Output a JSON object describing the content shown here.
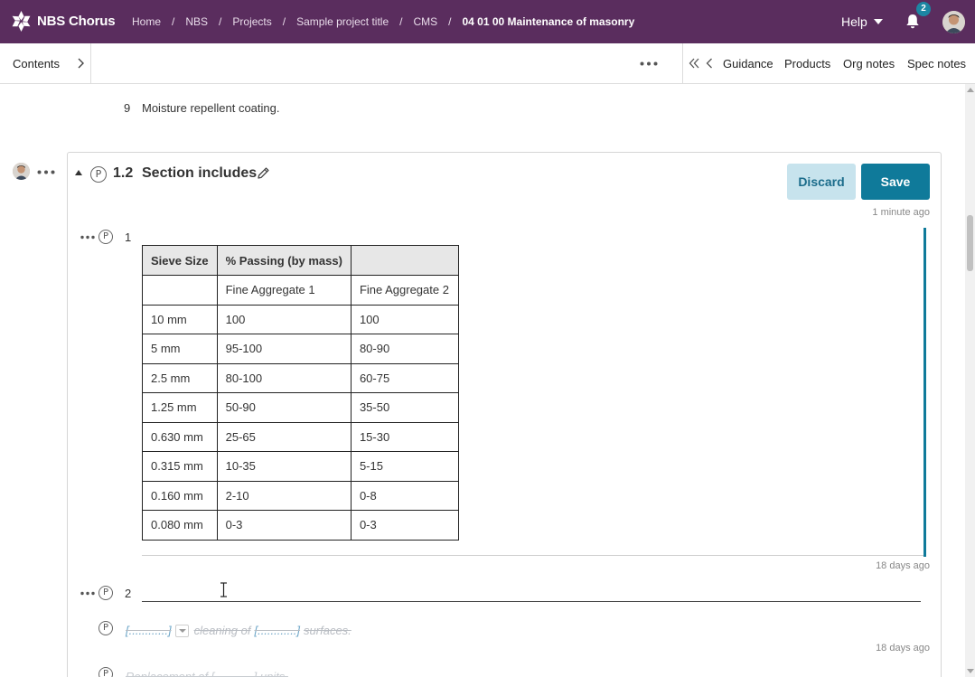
{
  "app": {
    "brand": "NBS Chorus",
    "breadcrumbs": [
      "Home",
      "NBS",
      "Projects",
      "Sample project title",
      "CMS",
      "04 01 00 Maintenance of masonry"
    ],
    "help_label": "Help",
    "notification_count": "2",
    "colors": {
      "header_bg": "#5a2d5e",
      "accent": "#0f7a9a",
      "discard_bg": "#c7e3ed"
    }
  },
  "toolbar": {
    "contents_label": "Contents",
    "right_tabs": [
      "Guidance",
      "Products",
      "Org notes",
      "Spec notes"
    ]
  },
  "document": {
    "previous_item": {
      "number": "9",
      "text": "Moisture repellent coating."
    },
    "clause": {
      "number": "1.2",
      "title": "Section includes",
      "p_marker": "P",
      "discard_label": "Discard",
      "save_label": "Save",
      "edited_time": "1 minute ago",
      "items": [
        {
          "number": "1",
          "time": "18 days ago",
          "table": {
            "headers": [
              "Sieve Size",
              "% Passing (by mass)",
              ""
            ],
            "rows": [
              [
                "",
                "Fine Aggregate 1",
                "Fine Aggregate 2"
              ],
              [
                "10 mm",
                "100",
                "100"
              ],
              [
                "5 mm",
                "95-100",
                "80-90"
              ],
              [
                "2.5 mm",
                "80-100",
                "60-75"
              ],
              [
                "1.25 mm",
                "50-90",
                "35-50"
              ],
              [
                "0.630 mm",
                "25-65",
                "15-30"
              ],
              [
                "0.315 mm",
                "10-35",
                "5-15"
              ],
              [
                "0.160 mm",
                "2-10",
                "0-8"
              ],
              [
                "0.080 mm",
                "0-3",
                "0-3"
              ]
            ]
          }
        },
        {
          "number": "2",
          "time": "18 days ago",
          "deleted_text": {
            "placeholder_1": "[............]",
            "middle": "cleaning of",
            "placeholder_2": "[............]",
            "end": "surfaces."
          },
          "next_deleted_text": "Replacement of [............] units."
        }
      ]
    }
  }
}
